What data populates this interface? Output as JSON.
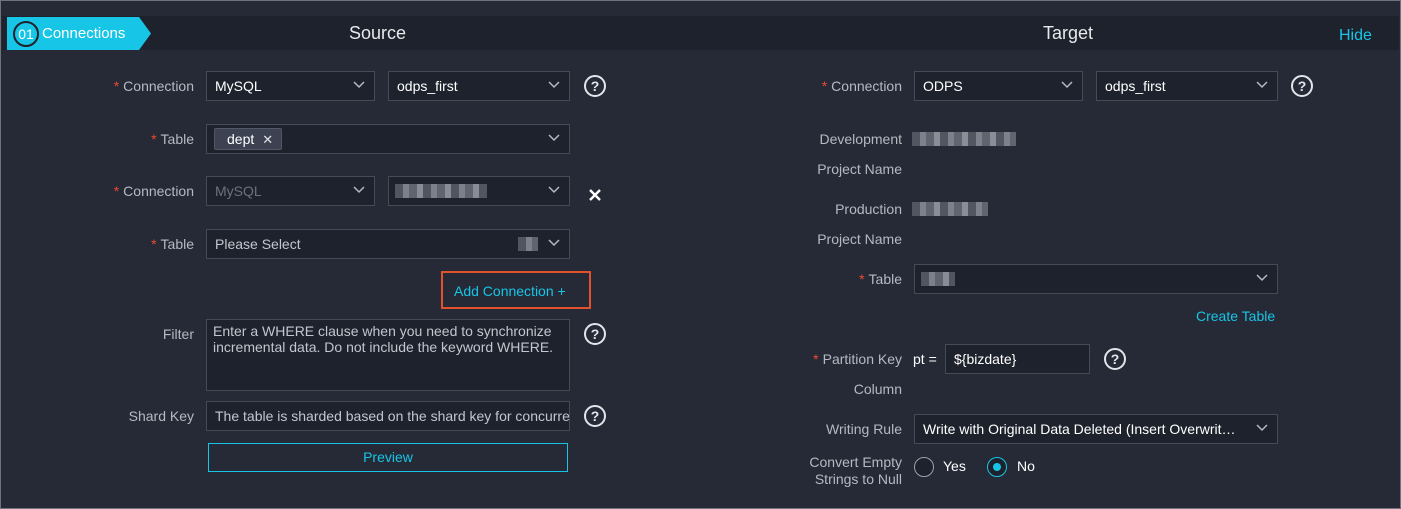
{
  "step": {
    "number": "01",
    "label": "Connections"
  },
  "header": {
    "source_title": "Source",
    "target_title": "Target",
    "hide_link": "Hide"
  },
  "source": {
    "row1": {
      "label": "Connection",
      "type_value": "MySQL",
      "name_value": "odps_first"
    },
    "row2": {
      "label": "Table",
      "tag": "dept"
    },
    "row3": {
      "label": "Connection",
      "type_value": "MySQL"
    },
    "row4": {
      "label": "Table",
      "placeholder": "Please Select"
    },
    "add_connection": "Add Connection +",
    "filter": {
      "label": "Filter",
      "placeholder": "Enter a WHERE clause when you need to synchronize incremental data. Do not include the keyword WHERE."
    },
    "shard_key": {
      "label": "Shard Key",
      "placeholder": "The table is sharded based on the shard key for concurrent reading."
    },
    "preview_button": "Preview"
  },
  "target": {
    "connection": {
      "label": "Connection",
      "type_value": "ODPS",
      "name_value": "odps_first"
    },
    "dev_project": {
      "label_line1": "Development",
      "label_line2": "Project Name"
    },
    "prod_project": {
      "label_line1": "Production",
      "label_line2": "Project Name"
    },
    "table": {
      "label": "Table"
    },
    "create_table": "Create Table",
    "partition": {
      "label_line1": "Partition Key",
      "label_line2": "Column",
      "prefix": "pt =",
      "value": "${bizdate}"
    },
    "writing_rule": {
      "label": "Writing Rule",
      "value": "Write with Original Data Deleted (Insert Overwrit…"
    },
    "convert_empty": {
      "label_line1": "Convert Empty",
      "label_line2": "Strings to Null",
      "yes": "Yes",
      "no": "No",
      "selected": "No"
    }
  },
  "required_mark": "*",
  "colors": {
    "accent": "#17c5e6",
    "required": "#f0492f",
    "highlight": "#e2512c",
    "background": "#262a36"
  }
}
